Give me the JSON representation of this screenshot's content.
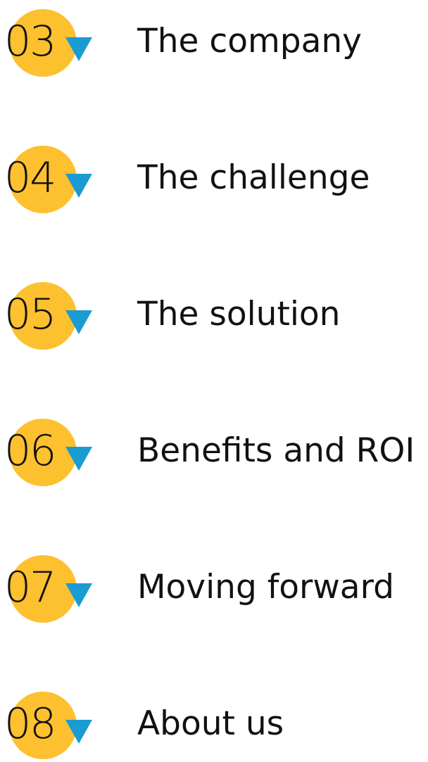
{
  "colors": {
    "circle": "#fdc02f",
    "arrow": "#1a9bd2",
    "text": "#111111",
    "background": "#ffffff"
  },
  "toc": {
    "items": [
      {
        "number": "03",
        "label": "The company"
      },
      {
        "number": "04",
        "label": "The challenge"
      },
      {
        "number": "05",
        "label": "The solution"
      },
      {
        "number": "06",
        "label": "Benefits and ROI"
      },
      {
        "number": "07",
        "label": "Moving forward"
      },
      {
        "number": "08",
        "label": "About us"
      }
    ]
  }
}
